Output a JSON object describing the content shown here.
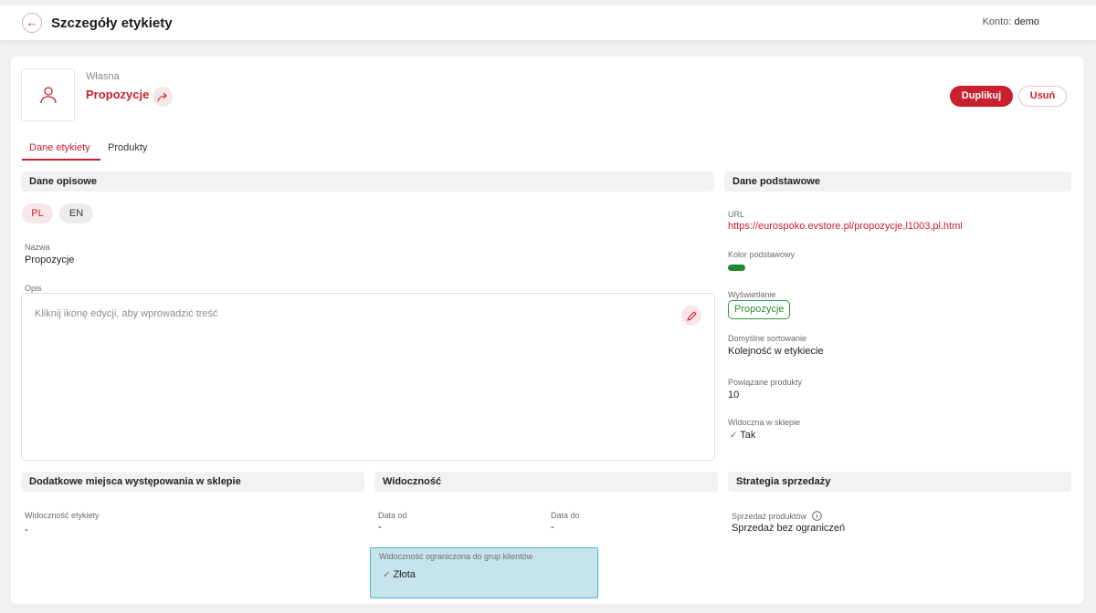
{
  "header": {
    "title": "Szczegóły etykiety",
    "account_label": "Konto:",
    "account_value": "demo"
  },
  "label": {
    "type": "Własna",
    "name": "Propozycje"
  },
  "actions": {
    "duplicate": "Duplikuj",
    "delete": "Usuń"
  },
  "tabs": [
    {
      "label": "Dane etykiety",
      "active": true
    },
    {
      "label": "Produkty",
      "active": false
    }
  ],
  "descriptive": {
    "title": "Dane opisowe",
    "languages": [
      "PL",
      "EN"
    ],
    "name_label": "Nazwa",
    "name_value": "Propozycje",
    "desc_label": "Opis",
    "desc_placeholder": "Kliknij ikonę edycji, aby wprowadzić treść"
  },
  "basic": {
    "title": "Dane podstawowe",
    "url_label": "URL",
    "url_value": "https://eurospoko.evstore.pl/propozycje,l1003,pl.html",
    "color_label": "Kolor podstawowy",
    "color_value": "#1e8a2f",
    "display_label": "Wyświetlanie",
    "display_value": "Propozycje",
    "sort_label": "Domyślne sortowanie",
    "sort_value": "Kolejność w etykiecie",
    "products_label": "Powiązane produkty",
    "products_value": "10",
    "visible_label": "Widoczna w sklepie",
    "visible_value": "Tak"
  },
  "extra": {
    "title": "Dodatkowe miejsca występowania w sklepie",
    "visibility_label": "Widoczność etykiety",
    "visibility_value": "-"
  },
  "visibility": {
    "title": "Widoczność",
    "date_from_label": "Data od",
    "date_from_value": "-",
    "date_to_label": "Data do",
    "date_to_value": "-",
    "groups_label": "Widoczność ograniczona do grup klientów",
    "groups_value": "Złota"
  },
  "strategy": {
    "title": "Strategia sprzedaży",
    "sales_label": "Sprzedaż produktów",
    "sales_value": "Sprzedaż bez ograniczeń"
  }
}
